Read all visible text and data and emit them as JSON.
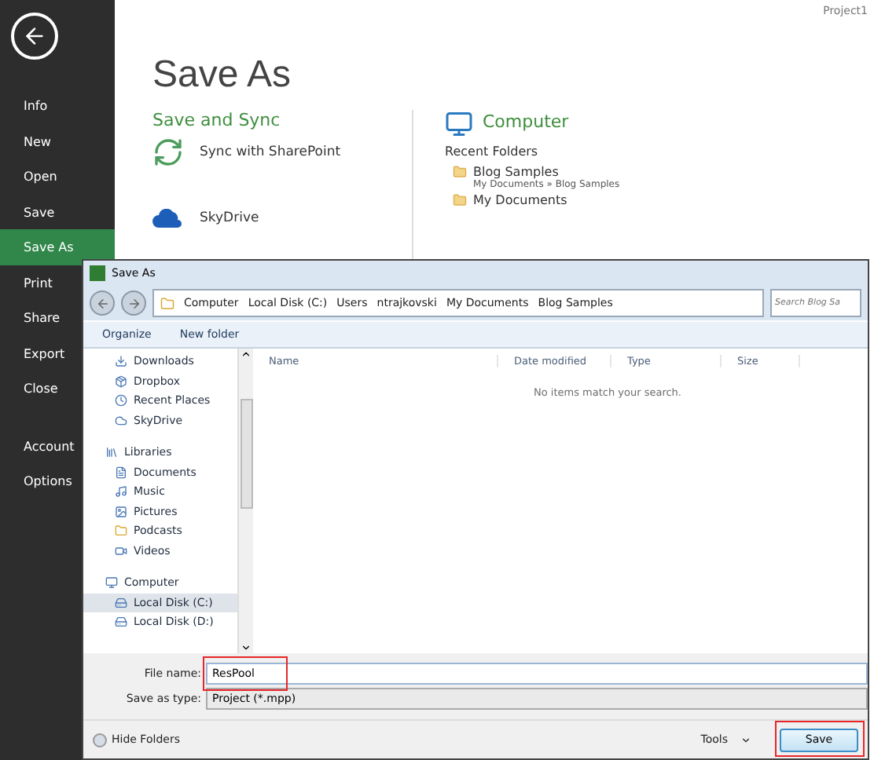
{
  "app": {
    "document": "Project1"
  },
  "sidebar": {
    "items": [
      {
        "label": "Info",
        "selected": false
      },
      {
        "label": "New",
        "selected": false
      },
      {
        "label": "Open",
        "selected": false
      },
      {
        "label": "Save",
        "selected": false
      },
      {
        "label": "Save As",
        "selected": true
      },
      {
        "label": "Print",
        "selected": false
      },
      {
        "label": "Share",
        "selected": false
      },
      {
        "label": "Export",
        "selected": false
      },
      {
        "label": "Close",
        "selected": false
      },
      {
        "label": "Account",
        "selected": false
      },
      {
        "label": "Options",
        "selected": false
      }
    ]
  },
  "page": {
    "title": "Save As",
    "left_heading": "Save and Sync",
    "places": [
      {
        "label": "Sync with SharePoint",
        "kind": "sync"
      },
      {
        "label": "SkyDrive",
        "kind": "cloud"
      }
    ],
    "right_heading": "Computer",
    "recent_label": "Recent Folders",
    "recent": [
      {
        "name": "Blog Samples",
        "path": "My Documents » Blog Samples"
      },
      {
        "name": "My Documents"
      }
    ]
  },
  "dialog": {
    "title": "Save As",
    "path": [
      "Computer",
      "Local Disk (C:)",
      "Users",
      "ntrajkovski",
      "My Documents",
      "Blog Samples"
    ],
    "search": {
      "placeholder": "Search Blog Sa"
    },
    "toolbar": [
      "Organize",
      "New folder"
    ],
    "nav": [
      {
        "label": "Downloads",
        "kind": "download",
        "selected": false
      },
      {
        "label": "Dropbox",
        "kind": "box",
        "selected": false
      },
      {
        "label": "Recent Places",
        "kind": "recent",
        "selected": false
      },
      {
        "label": "SkyDrive",
        "kind": "cloud",
        "selected": false
      },
      {
        "label": "Libraries",
        "kind": "library",
        "group": true,
        "selected": false
      },
      {
        "label": "Documents",
        "kind": "doc",
        "selected": false
      },
      {
        "label": "Music",
        "kind": "music",
        "selected": false
      },
      {
        "label": "Pictures",
        "kind": "picture",
        "selected": false
      },
      {
        "label": "Podcasts",
        "kind": "folder",
        "selected": false
      },
      {
        "label": "Videos",
        "kind": "video",
        "selected": false
      },
      {
        "label": "Computer",
        "kind": "computer",
        "group": true,
        "selected": false
      },
      {
        "label": "Local Disk (C:)",
        "kind": "disk",
        "selected": true
      },
      {
        "label": "Local Disk (D:)",
        "kind": "disk",
        "selected": false
      }
    ],
    "columns": [
      "Name",
      "Date modified",
      "Type",
      "Size"
    ],
    "empty_message": "No items match your search.",
    "file_name_label": "File name:",
    "file_name": "ResPool",
    "type_label": "Save as type:",
    "type": "Project (*.mpp)",
    "hide_folders": "Hide Folders",
    "tools": "Tools",
    "save": "Save"
  }
}
